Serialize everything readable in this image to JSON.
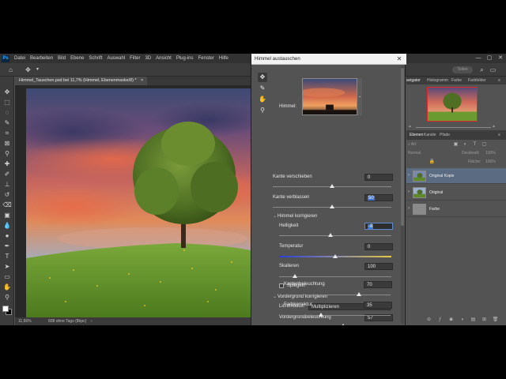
{
  "menubar": {
    "logo": "Ps",
    "items": [
      "Datei",
      "Bearbeiten",
      "Bild",
      "Ebene",
      "Schrift",
      "Auswahl",
      "Filter",
      "3D",
      "Ansicht",
      "Plug-ins",
      "Fenster",
      "Hilfe"
    ],
    "window_controls": [
      "—",
      "▢",
      "✕"
    ]
  },
  "optionsbar": {
    "share": "Teilen"
  },
  "document": {
    "tab_title": "Himmel_Tauschen.psd bei 11,7% (Himmel, Ebenenmaske/8) *",
    "tab_close": "×",
    "zoom": "11,66%",
    "status": "608 ohne Tags (8bpc)"
  },
  "dialog": {
    "title": "Himmel austauschen",
    "close": "✕",
    "sky_label": "Himmel:",
    "kante_verschieben": {
      "label": "Kante verschieben",
      "value": "0",
      "level": 0.5
    },
    "kante_verblassen": {
      "label": "Kante verblassen",
      "value": "50",
      "level": 0.5
    },
    "himmel_section": "Himmel korrigieren",
    "helligkeit": {
      "label": "Helligkeit",
      "value": "-8",
      "level": 0.46
    },
    "temperatur": {
      "label": "Temperatur",
      "value": "0",
      "level": 0.5
    },
    "skalieren": {
      "label": "Skalieren",
      "value": "100",
      "level": 0.14
    },
    "spiegeln": "Spiegeln",
    "vordergrund_section": "Vordergrund korrigieren",
    "lichtmodus_label": "Lichtmodus:",
    "lichtmodus_value": "Multiplizieren",
    "vordergrundbeleuchtung": {
      "label": "Vordergrundbeleuchtung",
      "value": "57",
      "level": 0.57
    },
    "kantenbeleuchtung": {
      "label": "Kantenbeleuchtung",
      "value": "70",
      "level": 0.7
    },
    "farbkorrektur": {
      "label": "Farbkorrektur",
      "value": "35",
      "level": 0.35
    }
  },
  "panels": {
    "top_tabs": [
      "avigator",
      "Histogramm",
      "Farbe",
      "Farbfelder"
    ],
    "layer_tabs": [
      "Ebenen",
      "Kanäle",
      "Pfade"
    ],
    "filter_label": "Art",
    "blend_mode": "Normal",
    "opacity_label": "Deckkraft:",
    "opacity_value": "100%",
    "fill_label": "Fläche:",
    "fill_value": "100%",
    "layers": [
      {
        "name": "Original Kopie"
      },
      {
        "name": "Original"
      },
      {
        "name": "Farbe"
      }
    ]
  },
  "colors": {
    "accent": "#31a8ff",
    "selection": "#3d74d0",
    "nav_frame": "#e02828"
  }
}
